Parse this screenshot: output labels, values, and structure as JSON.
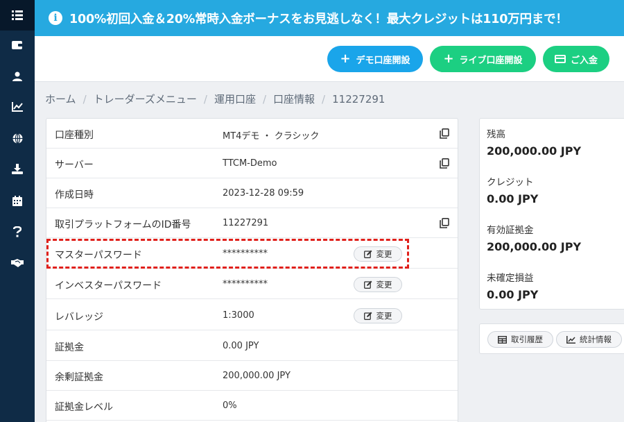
{
  "banner": {
    "icon": "info-icon",
    "text": "100%初回入金＆20%常時入金ボーナスをお見逃しなく！最大クレジットは110万円まで！"
  },
  "sidebar": {
    "items": [
      {
        "icon": "list-icon"
      },
      {
        "icon": "wallet-icon"
      },
      {
        "icon": "user-icon"
      },
      {
        "icon": "chart-icon"
      },
      {
        "icon": "globe-icon"
      },
      {
        "icon": "download-icon"
      },
      {
        "icon": "calendar-icon"
      },
      {
        "icon": "help-icon"
      },
      {
        "icon": "handshake-icon"
      }
    ]
  },
  "actions": {
    "demo_label": "デモ口座開設",
    "live_label": "ライブ口座開設",
    "deposit_label": "ご入金"
  },
  "breadcrumb": [
    "ホーム",
    "トレーダーズメニュー",
    "運用口座",
    "口座情報",
    "11227291"
  ],
  "account_info": {
    "rows": [
      {
        "label": "口座種別",
        "value": "MT4デモ ・ クラシック"
      },
      {
        "label": "サーバー",
        "value": "TTCM-Demo"
      },
      {
        "label": "作成日時",
        "value": "2023-12-28 09:59"
      },
      {
        "label": "取引プラットフォームのID番号",
        "value": "11227291"
      },
      {
        "label": "マスターパスワード",
        "value": "**********"
      },
      {
        "label": "インベスターパスワード",
        "value": "**********"
      },
      {
        "label": "レバレッジ",
        "value": "1:3000"
      },
      {
        "label": "証拠金",
        "value": "0.00 JPY"
      },
      {
        "label": "余剰証拠金",
        "value": "200,000.00 JPY"
      },
      {
        "label": "証拠金レベル",
        "value": "0%"
      }
    ],
    "change_label": "変更"
  },
  "summary": {
    "items": [
      {
        "label": "残高",
        "value": "200,000.00 JPY"
      },
      {
        "label": "クレジット",
        "value": "0.00 JPY"
      },
      {
        "label": "有効証拠金",
        "value": "200,000.00 JPY"
      },
      {
        "label": "未確定損益",
        "value": "0.00 JPY"
      }
    ]
  },
  "tools": {
    "history_label": "取引履歴",
    "stats_label": "統計情報"
  },
  "colors": {
    "sidebar": "#0f2b46",
    "banner": "#26a9e0",
    "demo_button": "#1aa5ea",
    "live_button": "#1ccf82",
    "highlight": "#e0201b"
  }
}
